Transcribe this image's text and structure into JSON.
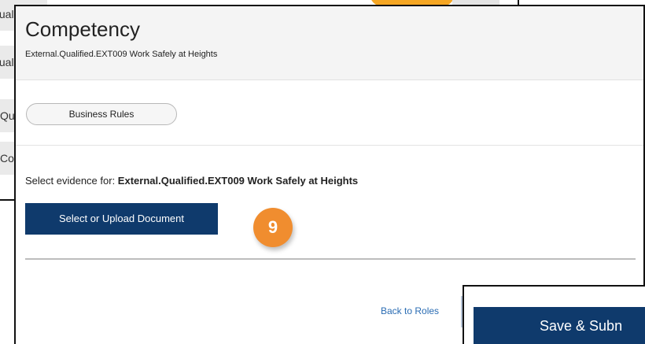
{
  "background": {
    "rows": [
      "Qualifi",
      "Qualifi",
      "Qu",
      "Co"
    ]
  },
  "modal": {
    "title": "Competency",
    "subtitle": "External.Qualified.EXT009 Work Safely at Heights",
    "business_rules_label": "Business Rules",
    "evidence_prefix": "Select evidence for: ",
    "evidence_target": "External.Qualified.EXT009 Work Safely at Heights",
    "upload_button_label": "Select or Upload Document",
    "back_link_label": "Back to Roles"
  },
  "step_badge": "9",
  "overlay": {
    "save_button_label": "Save & Subn"
  },
  "colors": {
    "primary_button": "#0f3a6c",
    "badge": "#f08d2f",
    "link": "#2a6cb3"
  }
}
